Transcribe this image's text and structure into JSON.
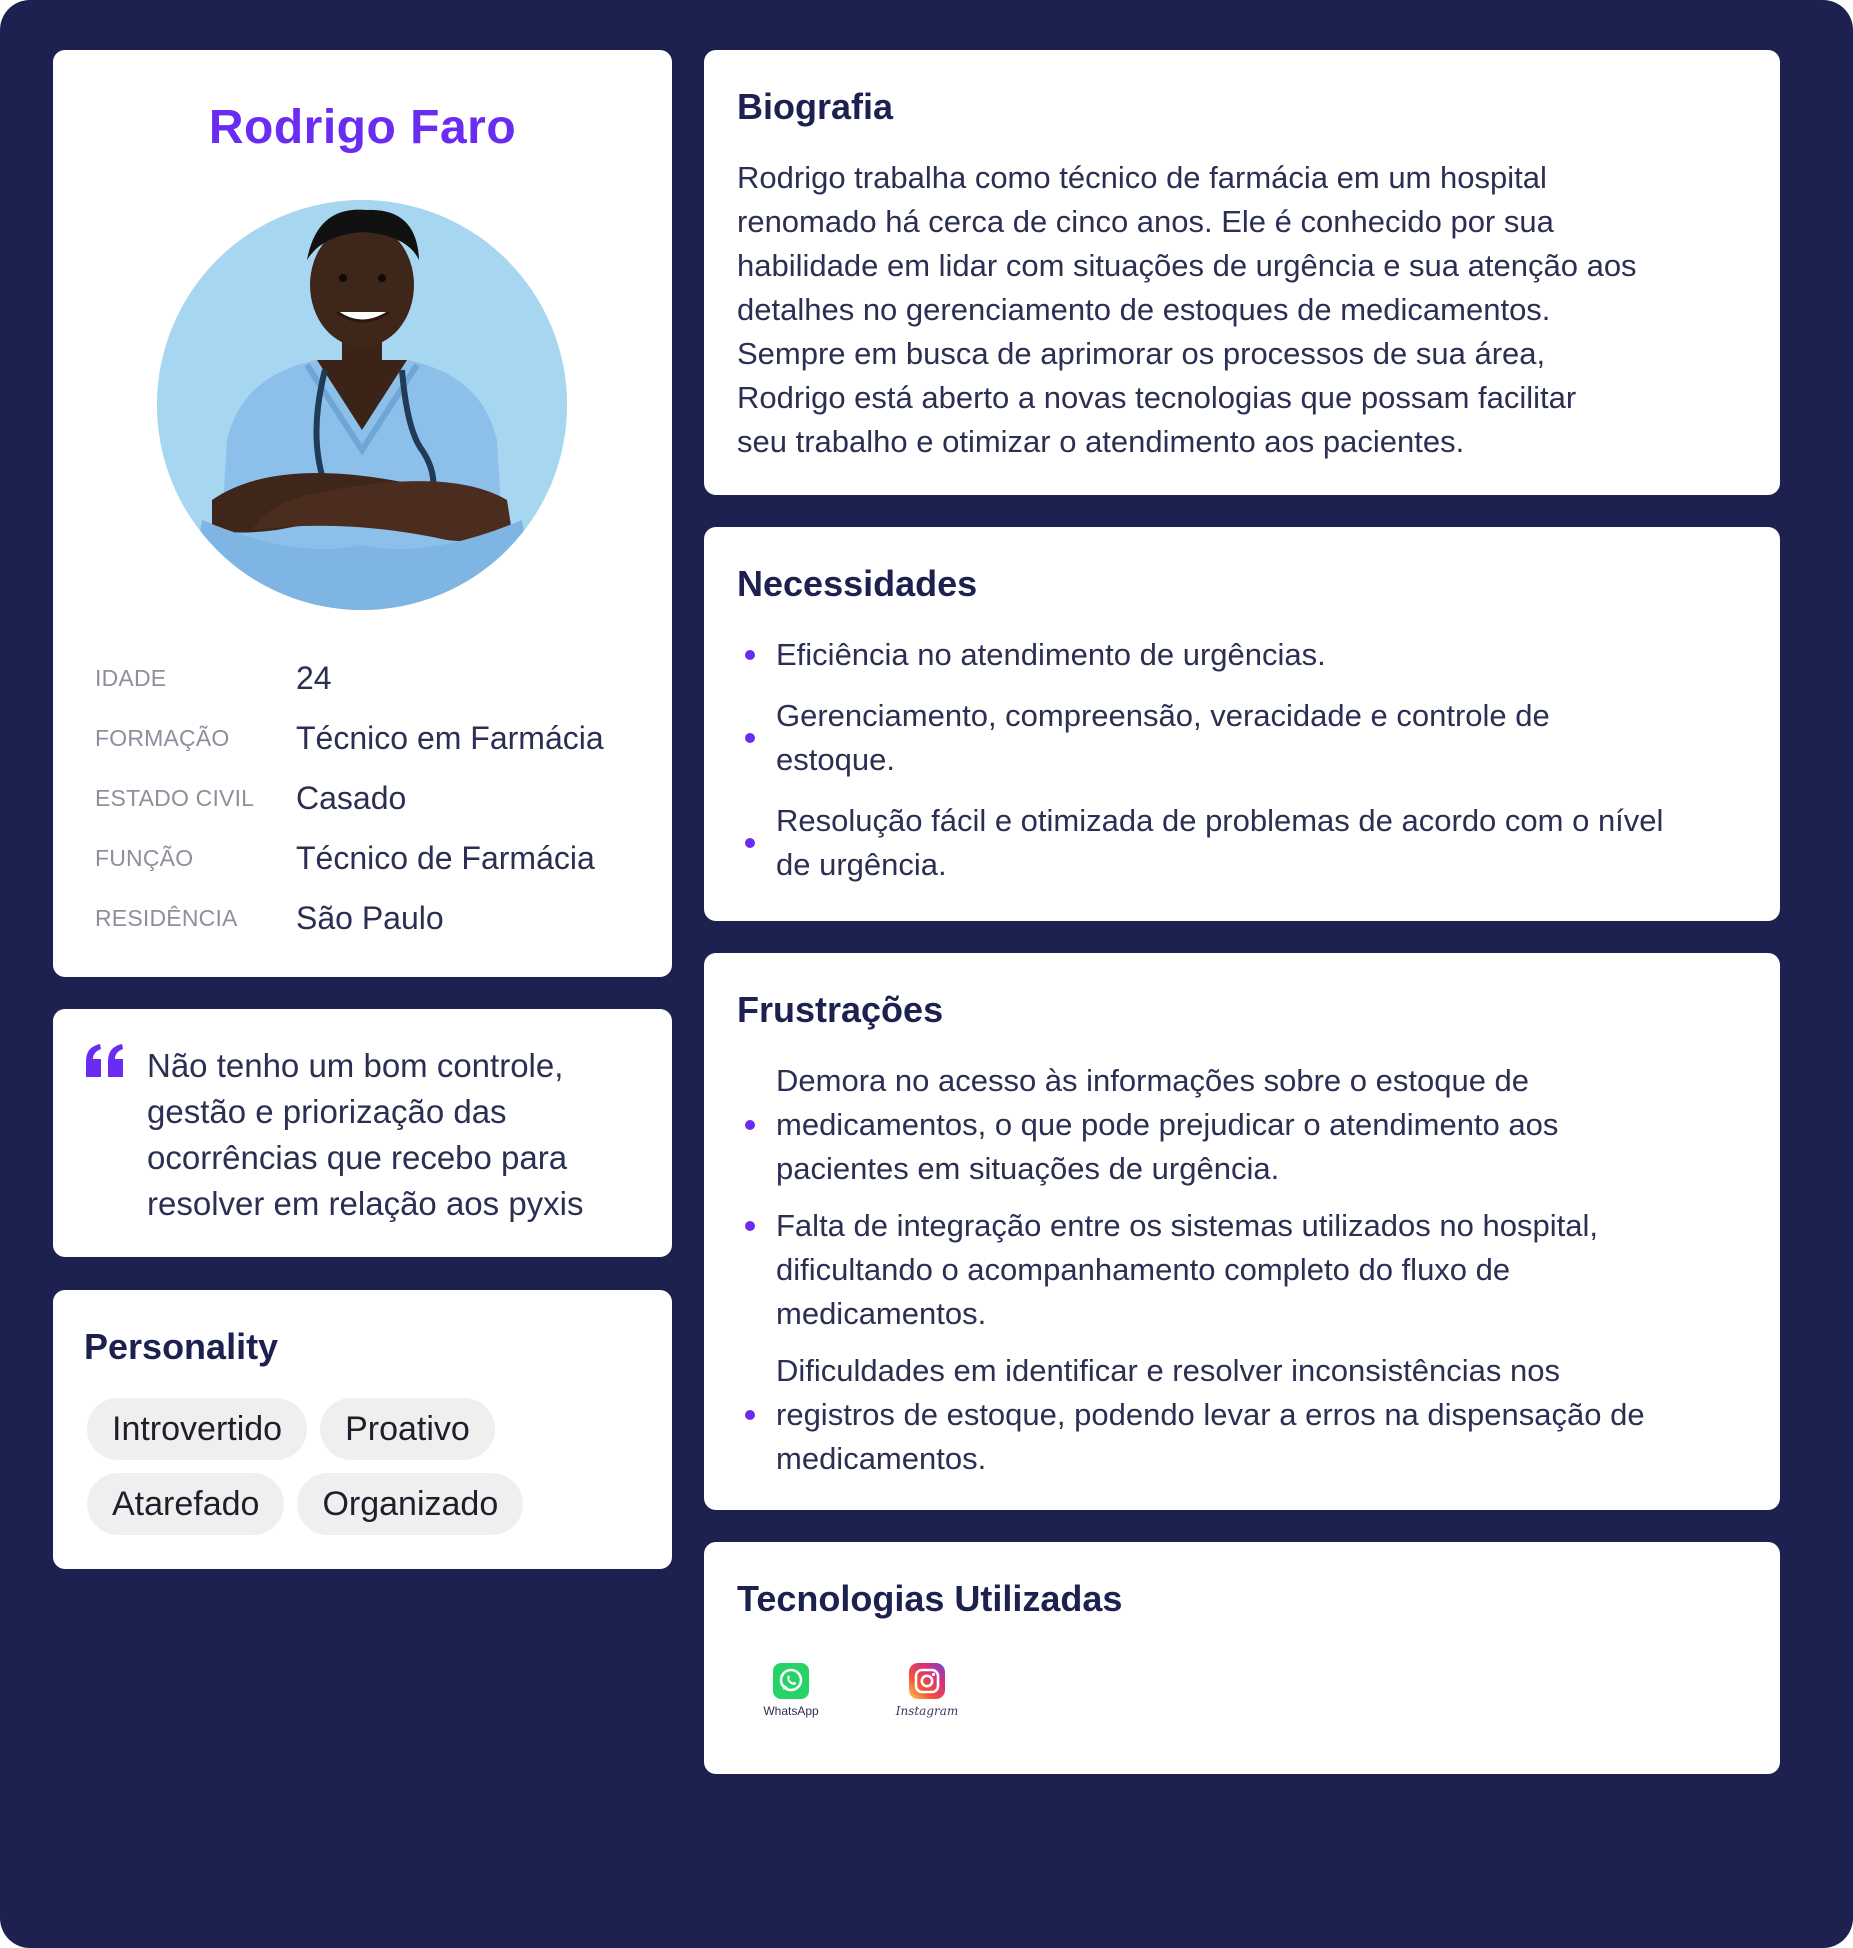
{
  "profile": {
    "name": "Rodrigo Faro",
    "facts": [
      {
        "label": "IDADE",
        "value": "24"
      },
      {
        "label": "FORMAÇÃO",
        "value": "Técnico em Farmácia"
      },
      {
        "label": "ESTADO CIVIL",
        "value": "Casado"
      },
      {
        "label": "FUNÇÃO",
        "value": "Técnico de Farmácia"
      },
      {
        "label": "RESIDÊNCIA",
        "value": "São Paulo"
      }
    ]
  },
  "quote": {
    "lines": [
      "Não tenho um bom controle,",
      "gestão e priorização das",
      "ocorrências que recebo para",
      "resolver em relação aos pyxis"
    ]
  },
  "personality": {
    "title": "Personality",
    "tags": [
      "Introvertido",
      "Proativo",
      "Atarefado",
      "Organizado"
    ]
  },
  "biography": {
    "title": "Biografia",
    "lines": [
      "Rodrigo trabalha como técnico de farmácia em um hospital",
      "renomado há cerca de cinco anos. Ele é conhecido por sua",
      "habilidade em lidar com situações de urgência e sua atenção aos",
      "detalhes no gerenciamento de estoques de medicamentos.",
      "Sempre em busca de aprimorar os processos de sua área,",
      "Rodrigo está aberto a novas tecnologias que possam facilitar",
      "seu trabalho e otimizar o atendimento aos pacientes."
    ]
  },
  "needs": {
    "title": "Necessidades",
    "items": [
      {
        "lines": [
          "Eficiência no atendimento de urgências."
        ]
      },
      {
        "lines": [
          "Gerenciamento, compreensão, veracidade e controle de",
          "estoque."
        ]
      },
      {
        "lines": [
          "Resolução fácil e otimizada de problemas de acordo com o nível",
          "de urgência."
        ]
      }
    ]
  },
  "frustrations": {
    "title": "Frustrações",
    "items": [
      {
        "lines": [
          "Demora no acesso às informações sobre o estoque de",
          "medicamentos, o que pode prejudicar o atendimento aos",
          "pacientes em situações de urgência."
        ]
      },
      {
        "lines": [
          "Falta de integração entre os sistemas utilizados no hospital,",
          "dificultando o acompanhamento completo do fluxo de",
          "medicamentos."
        ]
      },
      {
        "lines": [
          "Dificuldades em identificar e resolver inconsistências nos",
          "registros de estoque, podendo levar a erros na dispensação de",
          "medicamentos."
        ]
      }
    ]
  },
  "technologies": {
    "title": "Tecnologias Utilizadas",
    "items": [
      {
        "label": "WhatsApp",
        "icon": "whatsapp-icon"
      },
      {
        "label": "Instagram",
        "icon": "instagram-icon"
      }
    ]
  },
  "colors": {
    "background": "#1c2150",
    "accent": "#6a2cf0",
    "card": "#ffffff",
    "tag": "#efefef"
  }
}
